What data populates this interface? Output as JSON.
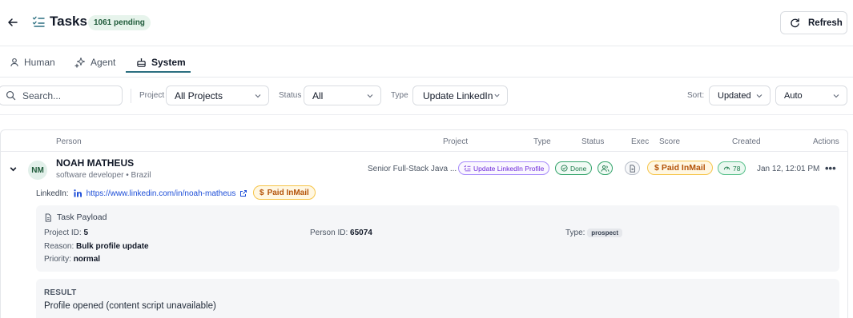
{
  "header": {
    "title": "Tasks",
    "pending_badge": "1061 pending",
    "refresh_label": "Refresh"
  },
  "tabs": [
    {
      "label": "Human",
      "icon": "person-icon",
      "active": false
    },
    {
      "label": "Agent",
      "icon": "sparkles-icon",
      "active": false
    },
    {
      "label": "System",
      "icon": "robot-icon",
      "active": true
    }
  ],
  "filters": {
    "search_placeholder": "Search...",
    "project_label": "Project",
    "project_value": "All Projects",
    "status_label": "Status",
    "status_value": "All",
    "type_label": "Type",
    "type_value": "Update LinkedIn...",
    "sort_label": "Sort:",
    "sort_value": "Updated",
    "auto_value": "Auto"
  },
  "table": {
    "columns": [
      "Person",
      "Project",
      "Type",
      "Status",
      "Exec",
      "Score",
      "Created",
      "Actions"
    ]
  },
  "row": {
    "initials": "NM",
    "name": "NOAH MATHEUS",
    "subtitle": "software developer • Brazil",
    "project": "Senior Full-Stack Java ...",
    "type": "Update LinkedIn Profile",
    "status": "Done",
    "score_label": "Paid InMail",
    "score_value": "78",
    "created": "Jan 12, 12:01 PM",
    "more": "•••",
    "linkedin_label": "LinkedIn:",
    "linkedin_url": "https://www.linkedin.com/in/noah-matheus",
    "linkedin_badge": "Paid InMail"
  },
  "payload": {
    "title": "Task Payload",
    "project_id_label": "Project ID:",
    "project_id": "5",
    "person_id_label": "Person ID:",
    "person_id": "65074",
    "type_label": "Type:",
    "type_value": "prospect",
    "reason_label": "Reason:",
    "reason": "Bulk profile update",
    "priority_label": "Priority:",
    "priority": "normal"
  },
  "result": {
    "title": "RESULT",
    "text": "Profile opened (content script unavailable)"
  },
  "colors": {
    "accent": "#2b6f80",
    "success": "#1c7a4a",
    "warning": "#b45309",
    "violet": "#6d28d9"
  }
}
